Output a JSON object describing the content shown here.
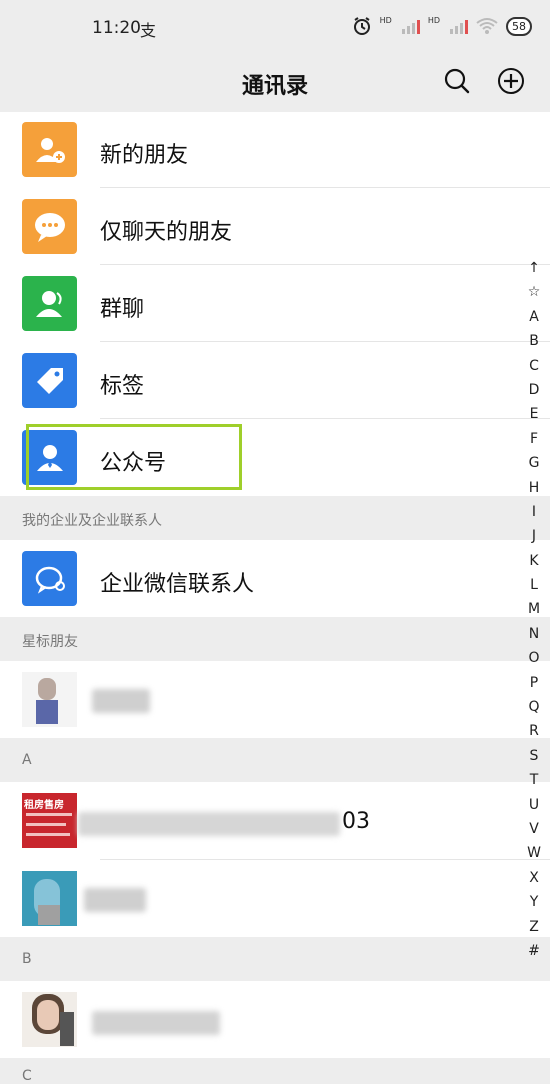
{
  "status_bar": {
    "time": "11:20",
    "pay_glyph": "支",
    "battery": "58"
  },
  "header": {
    "title": "通讯录"
  },
  "menu": [
    {
      "label": "新的朋友",
      "icon": "new-friend-icon",
      "color": "#f5a03a"
    },
    {
      "label": "仅聊天的朋友",
      "icon": "chat-only-icon",
      "color": "#f5a03a"
    },
    {
      "label": "群聊",
      "icon": "group-chat-icon",
      "color": "#2bb34c"
    },
    {
      "label": "标签",
      "icon": "tag-icon",
      "color": "#2c7be5"
    },
    {
      "label": "公众号",
      "icon": "official-account-icon",
      "color": "#2c7be5"
    }
  ],
  "enterprise": {
    "header": "我的企业及企业联系人",
    "label": "企业微信联系人",
    "icon": "enterprise-wechat-icon",
    "color": "#2c7be5"
  },
  "starred": {
    "header": "星标朋友"
  },
  "section_a": {
    "header": "A",
    "contact1_suffix": "03",
    "avatar1_text": "租房售房"
  },
  "section_b": {
    "header": "B"
  },
  "section_c": {
    "header": "C"
  },
  "alpha_index": [
    "↑",
    "☆",
    "A",
    "B",
    "C",
    "D",
    "E",
    "F",
    "G",
    "H",
    "I",
    "J",
    "K",
    "L",
    "M",
    "N",
    "O",
    "P",
    "Q",
    "R",
    "S",
    "T",
    "U",
    "V",
    "W",
    "X",
    "Y",
    "Z",
    "#"
  ]
}
